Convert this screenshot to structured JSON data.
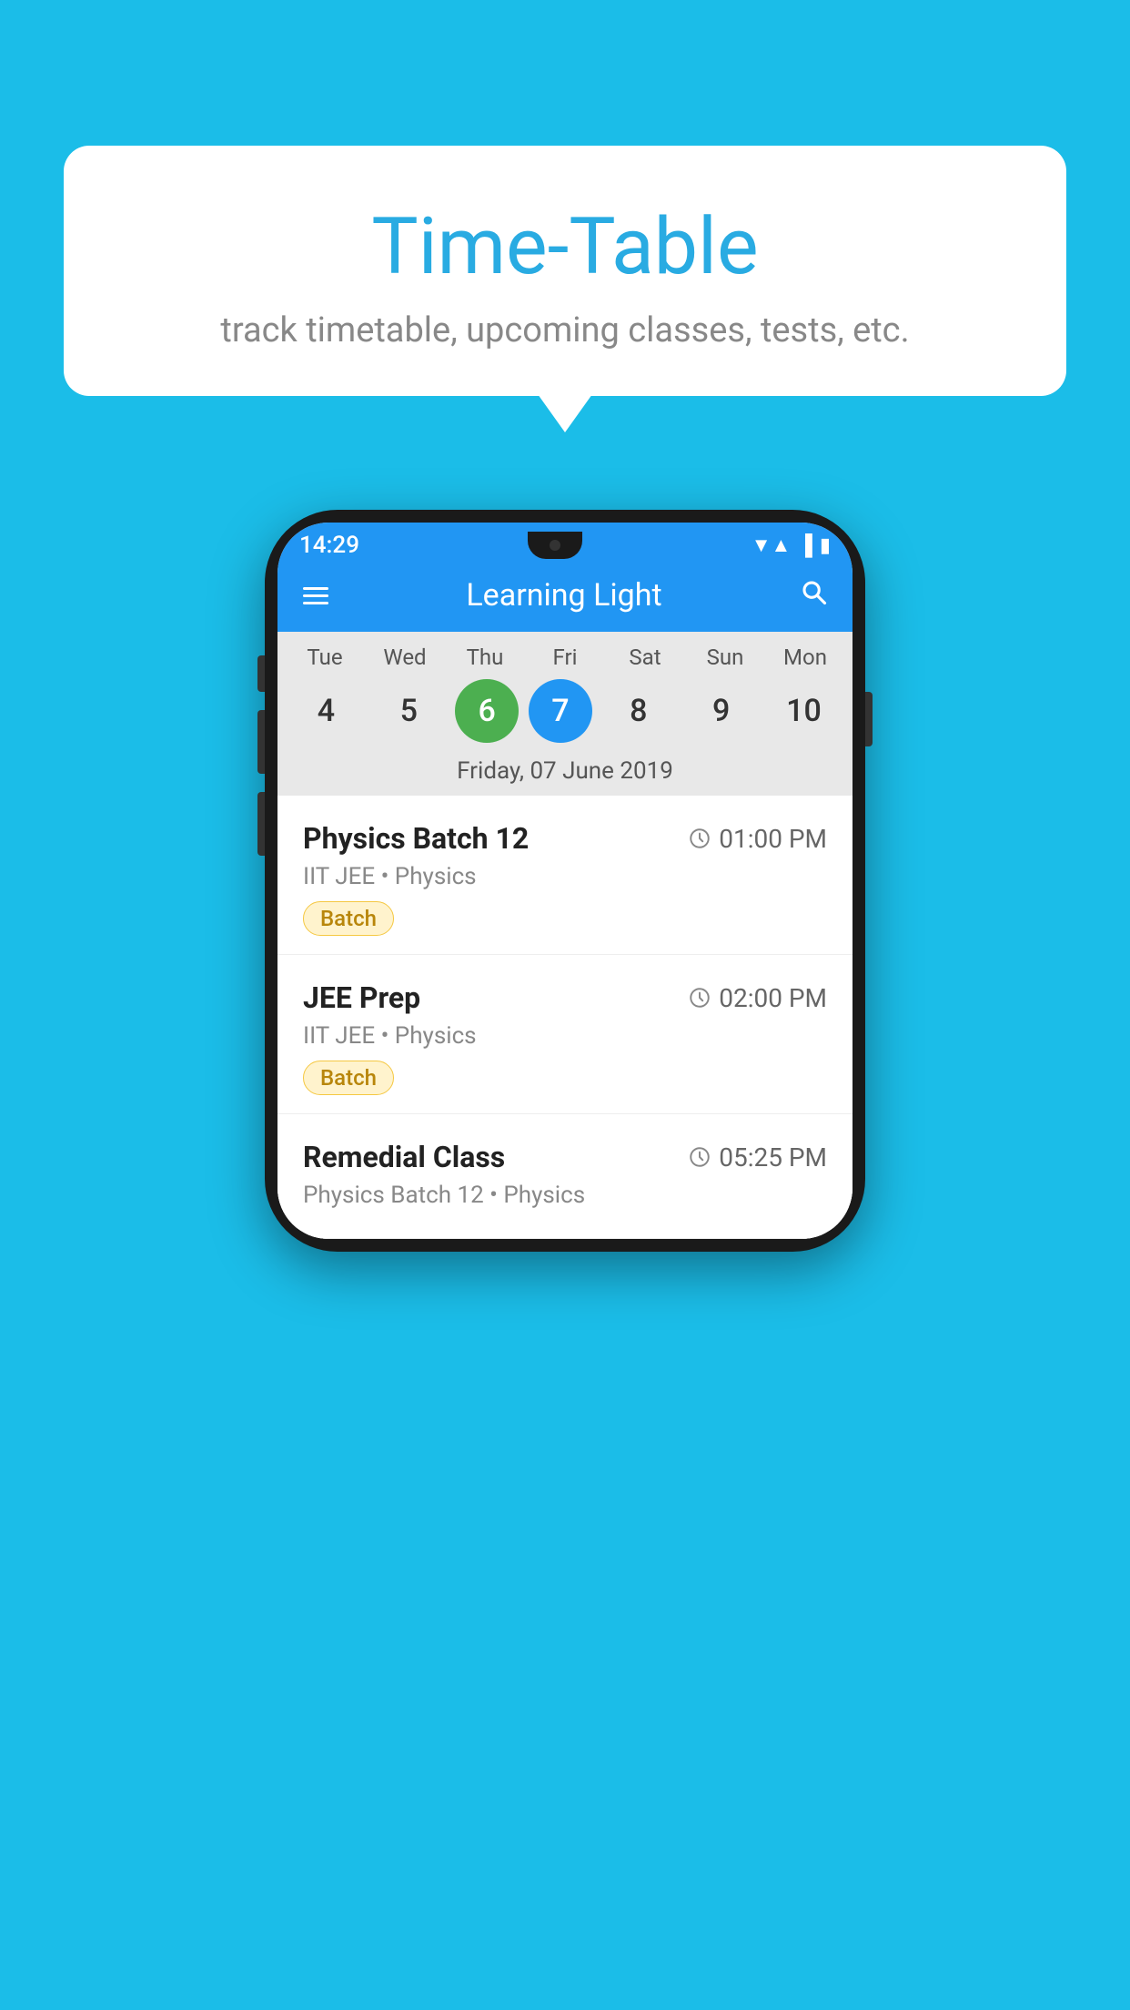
{
  "background": {
    "color": "#1BBDE8"
  },
  "tooltip": {
    "title": "Time-Table",
    "subtitle": "track timetable, upcoming classes, tests, etc."
  },
  "phone": {
    "status_bar": {
      "time": "14:29"
    },
    "app_header": {
      "title": "Learning Light"
    },
    "calendar": {
      "days": [
        {
          "name": "Tue",
          "num": "4",
          "state": "normal"
        },
        {
          "name": "Wed",
          "num": "5",
          "state": "normal"
        },
        {
          "name": "Thu",
          "num": "6",
          "state": "today"
        },
        {
          "name": "Fri",
          "num": "7",
          "state": "selected"
        },
        {
          "name": "Sat",
          "num": "8",
          "state": "normal"
        },
        {
          "name": "Sun",
          "num": "9",
          "state": "normal"
        },
        {
          "name": "Mon",
          "num": "10",
          "state": "normal"
        }
      ],
      "selected_date_label": "Friday, 07 June 2019"
    },
    "schedule": [
      {
        "title": "Physics Batch 12",
        "time": "01:00 PM",
        "subtitle": "IIT JEE • Physics",
        "badge": "Batch"
      },
      {
        "title": "JEE Prep",
        "time": "02:00 PM",
        "subtitle": "IIT JEE • Physics",
        "badge": "Batch"
      },
      {
        "title": "Remedial Class",
        "time": "05:25 PM",
        "subtitle": "Physics Batch 12 • Physics",
        "badge": ""
      }
    ]
  }
}
